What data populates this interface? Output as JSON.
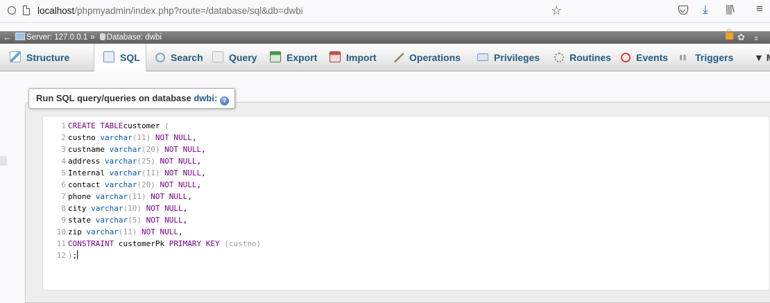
{
  "browser": {
    "url_host": "localhost",
    "url_path": "/phpmyadmin/index.php?route=/database/sql&db=dwbi",
    "icons": [
      "shield-icon",
      "page-icon",
      "star-icon",
      "pocket-icon",
      "download-icon",
      "library-icon",
      "menu-icon"
    ]
  },
  "breadcrumb": {
    "back": "←",
    "server": "Server: 127.0.0.1",
    "sep": "»",
    "database": "Database: dwbi",
    "collapse": "⌅"
  },
  "tabs": [
    {
      "label": "Structure",
      "color": "#6aa5d8"
    },
    {
      "label": "SQL",
      "color": "#6f8fbf"
    },
    {
      "label": "Search",
      "color": "#7fa4cc"
    },
    {
      "label": "Query",
      "color": "#b6b6b6"
    },
    {
      "label": "Export",
      "color": "#4a9a4a"
    },
    {
      "label": "Import",
      "color": "#c8504a"
    },
    {
      "label": "Operations",
      "color": "#9a8060"
    },
    {
      "label": "Privileges",
      "color": "#7a9ac0"
    },
    {
      "label": "Routines",
      "color": "#8a8a8a"
    },
    {
      "label": "Events",
      "color": "#d0463a"
    },
    {
      "label": "Triggers",
      "color": "#9a9a9a"
    },
    {
      "label": "▼ M",
      "color": ""
    }
  ],
  "legend": {
    "text": "Run SQL query/queries on database",
    "db": "dwbi:"
  },
  "editor": {
    "lines": [
      {
        "n": "1",
        "parts": [
          [
            "kw",
            "CREATE TABLE"
          ],
          [
            "",
            "customer "
          ],
          [
            "br",
            "("
          ]
        ]
      },
      {
        "n": "2",
        "parts": [
          [
            "",
            "custno "
          ],
          [
            "ty",
            "varchar"
          ],
          [
            "br",
            "(11)"
          ],
          [
            "",
            ""
          ],
          [
            "kw",
            " NOT NULL"
          ],
          [
            "",
            ","
          ]
        ]
      },
      {
        "n": "3",
        "parts": [
          [
            "",
            "custname "
          ],
          [
            "ty",
            "varchar"
          ],
          [
            "br",
            "(20)"
          ],
          [
            "kw",
            " NOT NULL"
          ],
          [
            "",
            ","
          ]
        ]
      },
      {
        "n": "4",
        "parts": [
          [
            "",
            "address "
          ],
          [
            "ty",
            "varchar"
          ],
          [
            "br",
            "(25)"
          ],
          [
            "kw",
            " NOT NULL"
          ],
          [
            "",
            ","
          ]
        ]
      },
      {
        "n": "5",
        "parts": [
          [
            "",
            "Internal "
          ],
          [
            "ty",
            "varchar"
          ],
          [
            "br",
            "(11)"
          ],
          [
            "kw",
            " NOT NULL"
          ],
          [
            "",
            ","
          ]
        ]
      },
      {
        "n": "6",
        "parts": [
          [
            "",
            "contact "
          ],
          [
            "ty",
            "varchar"
          ],
          [
            "br",
            "(20)"
          ],
          [
            "kw",
            " NOT NULL"
          ],
          [
            "",
            ","
          ]
        ]
      },
      {
        "n": "7",
        "parts": [
          [
            "",
            "phone "
          ],
          [
            "ty",
            "varchar"
          ],
          [
            "br",
            "(11)"
          ],
          [
            "kw",
            " NOT NULL"
          ],
          [
            "",
            ","
          ]
        ]
      },
      {
        "n": "8",
        "parts": [
          [
            "",
            "city "
          ],
          [
            "ty",
            "varchar"
          ],
          [
            "br",
            "(10)"
          ],
          [
            "kw",
            " NOT NULL"
          ],
          [
            "",
            ","
          ]
        ]
      },
      {
        "n": "9",
        "parts": [
          [
            "",
            "state "
          ],
          [
            "ty",
            "varchar"
          ],
          [
            "br",
            "(5)"
          ],
          [
            "kw",
            " NOT NULL"
          ],
          [
            "",
            ","
          ]
        ]
      },
      {
        "n": "10",
        "parts": [
          [
            "",
            "zip "
          ],
          [
            "ty",
            "varchar"
          ],
          [
            "br",
            "(11)"
          ],
          [
            "kw",
            " NOT NULL"
          ],
          [
            "",
            ","
          ]
        ]
      },
      {
        "n": "11",
        "parts": [
          [
            "kw",
            "CONSTRAINT"
          ],
          [
            "",
            ""
          ],
          [
            "",
            " customerPk "
          ],
          [
            "kw",
            "PRIMARY KEY"
          ],
          [
            "",
            ""
          ],
          [
            "br",
            " (custno)"
          ]
        ]
      },
      {
        "n": "12",
        "parts": [
          [
            "br",
            ")"
          ],
          [
            "",
            ";"
          ]
        ]
      }
    ]
  }
}
